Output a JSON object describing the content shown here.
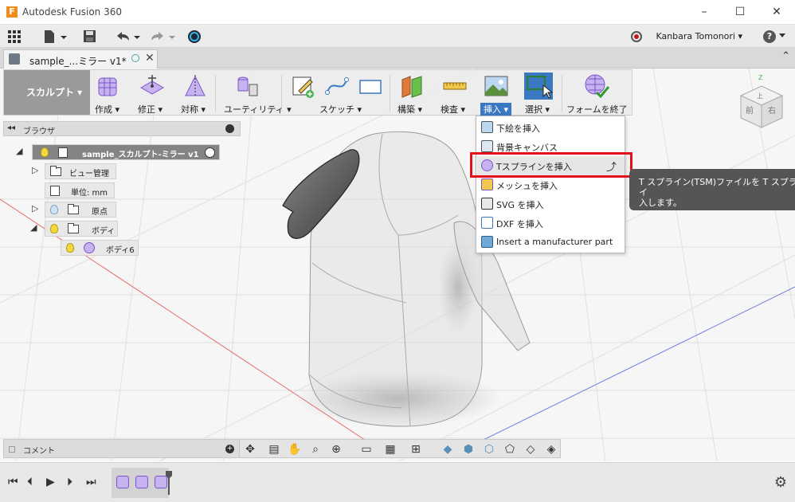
{
  "app": {
    "icon_letter": "F",
    "title": "Autodesk Fusion 360"
  },
  "window_controls": {
    "minimize": "–",
    "maximize": "☐",
    "close": "✕"
  },
  "qat": {
    "user_name": "Kanbara Tomonori ▾",
    "help": "?"
  },
  "document_tab": {
    "label": "sample_...ミラー v1*",
    "close": "✕"
  },
  "ribbon": {
    "workspace": "スカルプト ▾",
    "groups": [
      {
        "label": "作成 ▾"
      },
      {
        "label": "修正 ▾"
      },
      {
        "label": "対称 ▾"
      },
      {
        "label": "ユーティリティ ▾"
      },
      {
        "label": "スケッチ ▾"
      },
      {
        "label": "構築 ▾"
      },
      {
        "label": "検査 ▾"
      },
      {
        "label": "挿入 ▾"
      },
      {
        "label": "選択 ▾"
      },
      {
        "label": "フォームを終了"
      }
    ]
  },
  "insert_menu": {
    "items": [
      {
        "label": "下絵を挿入",
        "icon": "image-icon"
      },
      {
        "label": "背景キャンバス",
        "icon": "canvas-icon"
      },
      {
        "label": "Tスプラインを挿入",
        "icon": "tspline-icon",
        "highlighted": true,
        "suffix": "⤴"
      },
      {
        "label": "メッシュを挿入",
        "icon": "mesh-icon"
      },
      {
        "label": "SVG を挿入",
        "icon": "svg-icon"
      },
      {
        "label": "DXF を挿入",
        "icon": "dxf-icon"
      },
      {
        "label": "Insert a manufacturer part",
        "icon": "manufacturer-part-icon"
      }
    ]
  },
  "tooltip": {
    "line1": "T スプライン(TSM)ファイルを T スプライ",
    "line2": "入します。"
  },
  "browser": {
    "title": "ブラウザ",
    "root": "sample_スカルプト-ミラー v1",
    "items": [
      {
        "label": "ビュー管理"
      },
      {
        "label": "単位: mm"
      },
      {
        "label": "原点"
      },
      {
        "label": "ボディ"
      },
      {
        "label": "ボディ6"
      }
    ]
  },
  "comments": {
    "label": "コメント",
    "add": "+"
  },
  "colors": {
    "accent": "#3b78c2",
    "highlight_box": "#e0131a",
    "workspace_button": "#9a9a9a",
    "tspline_body": "#c7b3ef"
  }
}
